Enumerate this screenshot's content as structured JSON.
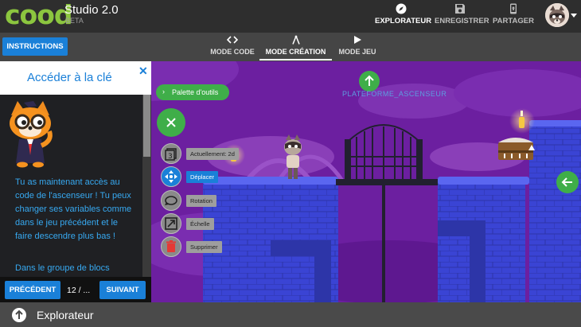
{
  "app": {
    "logo_text": "cood",
    "title": "Studio 2.0",
    "badge": "BETA"
  },
  "nav": [
    {
      "label": "EXPLORATEUR",
      "icon": "compass-icon",
      "active": true
    },
    {
      "label": "ENREGISTRER",
      "icon": "save-icon",
      "active": false
    },
    {
      "label": "PARTAGER",
      "icon": "share-icon",
      "active": false
    }
  ],
  "instructions_label": "INSTRUCTIONS",
  "modes": [
    {
      "label": "MODE CODE",
      "icon": "code-icon",
      "active": false
    },
    {
      "label": "MODE CRÉATION",
      "icon": "compass-tool-icon",
      "active": true
    },
    {
      "label": "MODE JEU",
      "icon": "play-icon",
      "active": false
    }
  ],
  "panel": {
    "title": "Accéder à la clé",
    "paragraph1": "Tu as maintenant accès au code de l'ascenseur ! Tu peux changer ses variables comme dans le jeu précédent et le faire descendre plus bas !",
    "paragraph2": "Dans le groupe de blocs",
    "prev_label": "PRÉCÉDENT",
    "page": "12 / ...",
    "next_label": "SUIVANT"
  },
  "scene": {
    "palette_label": "Palette d'outils",
    "platform_label": "PLATEFORME_ASCENSEUR",
    "tools": [
      {
        "label": "Actuellement: 2d",
        "icon": "layers-3-icon",
        "selected": false
      },
      {
        "label": "Déplacer",
        "icon": "move-icon",
        "selected": true
      },
      {
        "label": "Rotation",
        "icon": "rotate-icon",
        "selected": false
      },
      {
        "label": "Échelle",
        "icon": "scale-icon",
        "selected": false
      },
      {
        "label": "Supprimer",
        "icon": "trash-icon",
        "selected": false
      }
    ]
  },
  "bottom": {
    "label": "Explorateur"
  },
  "colors": {
    "accent_blue": "#1a80d8",
    "green": "#3fae49",
    "logo_green": "#8cc63f",
    "scene_purple": "#6c1fa0",
    "platform_blue": "#3b46d6",
    "instruction_text": "#37a9f1"
  }
}
